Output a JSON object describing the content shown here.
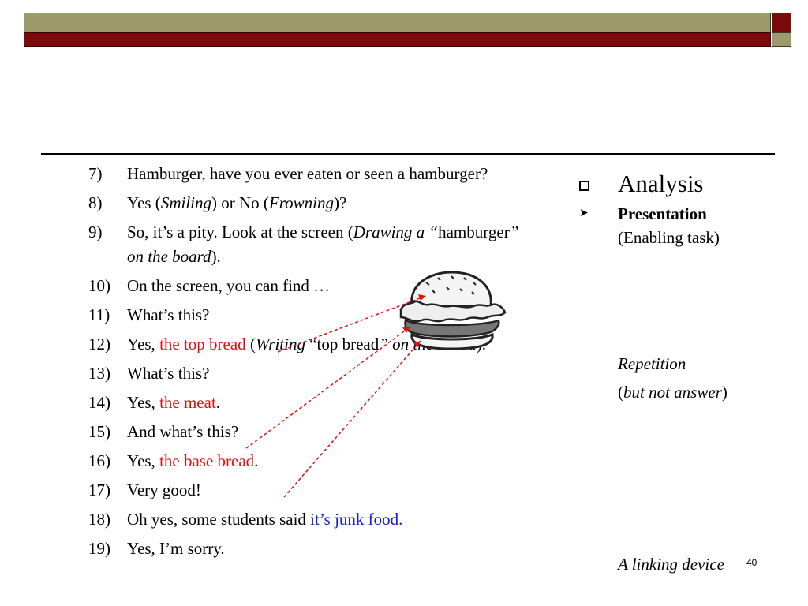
{
  "slide": {
    "items": [
      {
        "num": "7)",
        "parts": [
          {
            "text": "Hamburger, have you ever eaten or seen a hamburger?",
            "style": "normal"
          }
        ]
      },
      {
        "num": "8)",
        "parts": [
          {
            "text": "Yes (",
            "style": "normal"
          },
          {
            "text": "Smiling",
            "style": "italic"
          },
          {
            "text": ") or No (",
            "style": "normal"
          },
          {
            "text": "Frowning",
            "style": "italic"
          },
          {
            "text": ")?",
            "style": "normal"
          }
        ]
      },
      {
        "num": "9)",
        "parts": [
          {
            "text": "So, it’s a pity. Look at the screen (",
            "style": "normal"
          },
          {
            "text": "Drawing a “",
            "style": "italic"
          },
          {
            "text": "hamburger",
            "style": "normal"
          },
          {
            "text": "” on the board",
            "style": "italic"
          },
          {
            "text": ").",
            "style": "normal"
          }
        ]
      },
      {
        "num": "10)",
        "parts": [
          {
            "text": "On the screen, you can find …",
            "style": "normal"
          }
        ]
      },
      {
        "num": "11)",
        "parts": [
          {
            "text": "What’s this?",
            "style": "normal"
          }
        ]
      },
      {
        "num": "12)",
        "parts": [
          {
            "text": "Yes, ",
            "style": "normal"
          },
          {
            "text": "the top bread",
            "style": "red"
          },
          {
            "text": " (",
            "style": "normal"
          },
          {
            "text": "Writing ",
            "style": "italic"
          },
          {
            "text": "“top bread",
            "style": "normal"
          },
          {
            "text": "” on the board",
            "style": "italic"
          },
          {
            "text": ").",
            "style": "normal"
          }
        ]
      },
      {
        "num": "13)",
        "parts": [
          {
            "text": "What’s this?",
            "style": "normal"
          }
        ]
      },
      {
        "num": "14)",
        "parts": [
          {
            "text": "Yes, ",
            "style": "normal"
          },
          {
            "text": "the meat",
            "style": "red"
          },
          {
            "text": ".",
            "style": "normal"
          }
        ]
      },
      {
        "num": "15)",
        "parts": [
          {
            "text": "And what’s this?",
            "style": "normal"
          }
        ]
      },
      {
        "num": "16)",
        "parts": [
          {
            "text": "Yes, ",
            "style": "normal"
          },
          {
            "text": "the base bread",
            "style": "red"
          },
          {
            "text": ".",
            "style": "normal"
          }
        ]
      },
      {
        "num": "17)",
        "parts": [
          {
            "text": "Very good!",
            "style": "normal"
          }
        ]
      },
      {
        "num": "18)",
        "parts": [
          {
            "text": "Oh yes, some students said ",
            "style": "normal"
          },
          {
            "text": "it’s junk food",
            "style": "blue"
          },
          {
            "text": ".",
            "style": "blue"
          }
        ]
      },
      {
        "num": "19)",
        "parts": [
          {
            "text": "Yes, I’m sorry.",
            "style": "normal"
          }
        ]
      }
    ],
    "sidebar": {
      "analysis": "Analysis",
      "presentation": "Presentation",
      "enabling_task": "(Enabling task)",
      "repetition": "Repetition",
      "but_not_answer_open": "(",
      "but_not_answer": "but not answer",
      "but_not_answer_close": ")",
      "linking_device": "A linking device"
    },
    "page_number": "40",
    "colors": {
      "header_olive": "#9c9a6b",
      "header_maroon": "#7b0a0a",
      "highlight_red": "#e01010",
      "highlight_blue": "#1020d0"
    },
    "image": {
      "icon": "hamburger-drawing"
    }
  }
}
